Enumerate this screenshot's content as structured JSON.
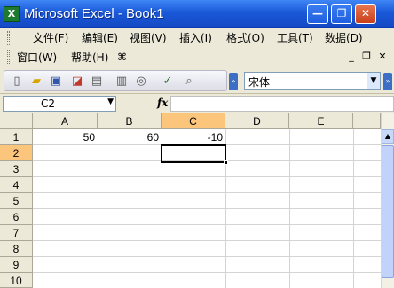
{
  "window": {
    "app_icon": "X",
    "title": "Microsoft Excel - Book1",
    "minimize_glyph": "—",
    "restore_glyph": "❐",
    "close_glyph": "✕"
  },
  "menu": {
    "file": "文件(F)",
    "edit": "编辑(E)",
    "view": "视图(V)",
    "insert": "插入(I)",
    "format": "格式(O)",
    "tools": "工具(T)",
    "data": "数据(D)",
    "window": "窗口(W)",
    "help": "帮助(H)",
    "mdi_minimize": "_",
    "mdi_restore": "❐",
    "mdi_close": "✕"
  },
  "toolbar": {
    "font_name": "宋体",
    "dropdown_glyph": "▼",
    "overflow_glyph": "»"
  },
  "formula_bar": {
    "name_box": "C2",
    "name_dropdown_glyph": "▼",
    "fx_label": "fx",
    "formula": ""
  },
  "sheet": {
    "columns": [
      "A",
      "B",
      "C",
      "D",
      "E"
    ],
    "rows": [
      "1",
      "2",
      "3",
      "4",
      "5",
      "6",
      "7",
      "8",
      "9",
      "10"
    ],
    "cells": {
      "A1": "50",
      "B1": "60",
      "C1": "-10"
    },
    "active_cell": "C2",
    "colors": {
      "active_header": "#fbc57c",
      "gridline": "#d4d4d4"
    }
  },
  "scrollbar": {
    "up_glyph": "▲"
  }
}
